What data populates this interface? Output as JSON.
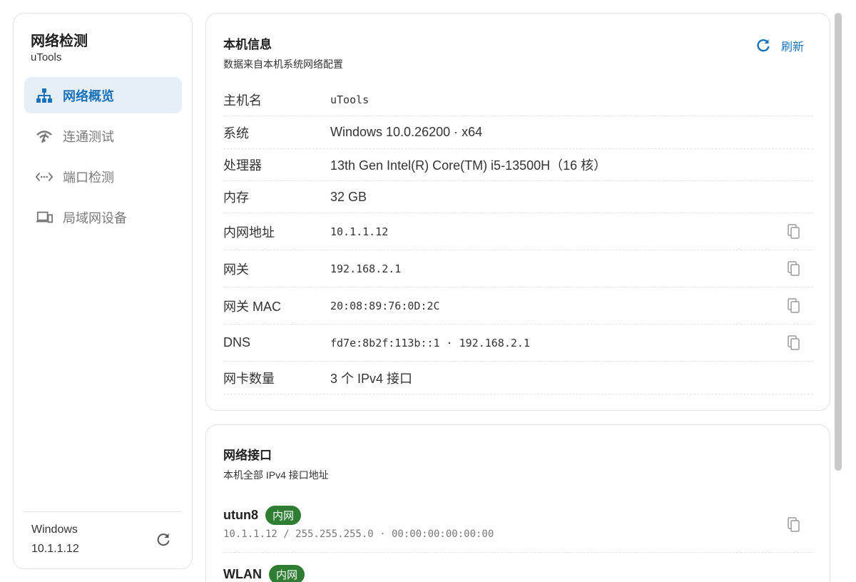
{
  "sidebar": {
    "title": "网络检测",
    "subtitle": "uTools",
    "items": [
      {
        "label": "网络概览",
        "icon": "network-icon",
        "active": true
      },
      {
        "label": "连通测试",
        "icon": "signal-icon",
        "active": false
      },
      {
        "label": "端口检测",
        "icon": "port-icon",
        "active": false
      },
      {
        "label": "局域网设备",
        "icon": "devices-icon",
        "active": false
      }
    ],
    "footer": {
      "os": "Windows",
      "ip": "10.1.1.12"
    }
  },
  "host_card": {
    "title": "本机信息",
    "subtitle": "数据来自本机系统网络配置",
    "refresh_label": "刷新",
    "rows": [
      {
        "label": "主机名",
        "value": "uTools",
        "mono": true,
        "copy": false
      },
      {
        "label": "系统",
        "value": "Windows 10.0.26200 · x64",
        "mono": false,
        "copy": false
      },
      {
        "label": "处理器",
        "value": "13th Gen Intel(R) Core(TM) i5-13500H（16 核）",
        "mono": false,
        "copy": false
      },
      {
        "label": "内存",
        "value": "32 GB",
        "mono": false,
        "copy": false
      },
      {
        "label": "内网地址",
        "value": "10.1.1.12",
        "mono": true,
        "copy": true
      },
      {
        "label": "网关",
        "value": "192.168.2.1",
        "mono": true,
        "copy": true
      },
      {
        "label": "网关 MAC",
        "value": "20:08:89:76:0D:2C",
        "mono": true,
        "copy": true
      },
      {
        "label": "DNS",
        "value": "fd7e:8b2f:113b::1 · 192.168.2.1",
        "mono": true,
        "copy": true
      },
      {
        "label": "网卡数量",
        "value": "3 个 IPv4 接口",
        "mono": false,
        "copy": false
      }
    ]
  },
  "iface_card": {
    "title": "网络接口",
    "subtitle": "本机全部 IPv4 接口地址",
    "interfaces": [
      {
        "name": "utun8",
        "badge": "内网",
        "detail": "10.1.1.12 / 255.255.255.0 · 00:00:00:00:00:00"
      },
      {
        "name": "WLAN",
        "badge": "内网",
        "detail": ""
      }
    ]
  },
  "colors": {
    "accent": "#1a73b8",
    "active_bg": "#e6eef7",
    "badge": "#2e7d32"
  }
}
